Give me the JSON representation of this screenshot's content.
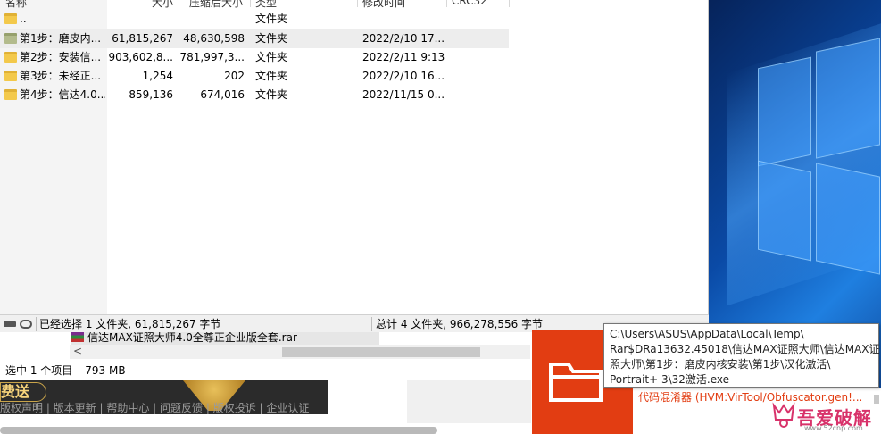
{
  "winrar": {
    "columns": [
      "名称",
      "大小",
      "压缩后大小",
      "类型",
      "修改时间",
      "CRC32"
    ],
    "rows": [
      {
        "name": "..",
        "size": "",
        "packed": "",
        "type": "文件夹",
        "modified": ""
      },
      {
        "name": "第1步：磨皮内...",
        "size": "61,815,267",
        "packed": "48,630,598",
        "type": "文件夹",
        "modified": "2022/2/10 17..."
      },
      {
        "name": "第2步：安装信...",
        "size": "903,602,8...",
        "packed": "781,997,3...",
        "type": "文件夹",
        "modified": "2022/2/11 9:13"
      },
      {
        "name": "第3步：未经正...",
        "size": "1,254",
        "packed": "202",
        "type": "文件夹",
        "modified": "2022/2/10 16..."
      },
      {
        "name": "第4步：信达4.0...",
        "size": "859,136",
        "packed": "674,016",
        "type": "文件夹",
        "modified": "2022/11/15 0..."
      }
    ],
    "status_left": "已经选择 1 文件夹, 61,815,267 字节",
    "status_right": "总计 4 文件夹, 966,278,556 字节"
  },
  "explorer": {
    "file_name": "信达MAX证照大师4.0全尊正企业版全套.rar",
    "scroll_left_arrow": "<",
    "status_selected": "选中 1 个项目",
    "status_size": "793 MB"
  },
  "background_page": {
    "promo_text": "费送",
    "footer_links": "版权声明 | 版本更新 | 帮助中心 | 问题反馈 | 版权投诉 | 企业认证"
  },
  "tooltip": {
    "lines": [
      "C:\\Users\\ASUS\\AppData\\Local\\Temp\\",
      "Rar$DRa13632.45018\\信达MAX证照大师\\信达MAX证",
      "照大师\\第1步：磨皮内核安装\\第1步\\汉化激活\\",
      "Portrait+ 3\\32激活.exe"
    ]
  },
  "taskbar_tile": {
    "icon": "folder-icon",
    "color": "#e23d12",
    "notice": "代码混淆器 (HVM:VirTool/Obfuscator.gen!..."
  },
  "watermark": {
    "text": "吾爱破解",
    "url": "www.52cnp.com"
  }
}
